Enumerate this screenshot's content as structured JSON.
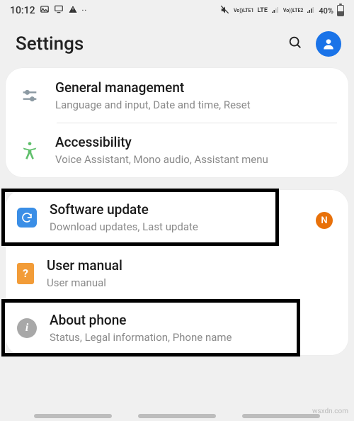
{
  "status": {
    "time": "10:12",
    "sim1": "Vo)) LTE LTE1",
    "sim2": "Vo)) LTE2",
    "battery": "40%"
  },
  "header": {
    "title": "Settings"
  },
  "group1": {
    "general": {
      "title": "General management",
      "sub": "Language and input, Date and time, Reset"
    },
    "accessibility": {
      "title": "Accessibility",
      "sub": "Voice Assistant, Mono audio, Assistant menu"
    }
  },
  "group2": {
    "software": {
      "title": "Software update",
      "sub": "Download updates, Last update",
      "badge": "N"
    },
    "manual": {
      "title": "User manual",
      "sub": "User manual"
    },
    "about": {
      "title": "About phone",
      "sub": "Status, Legal information, Phone name"
    }
  },
  "watermark": "wsxdn.com"
}
